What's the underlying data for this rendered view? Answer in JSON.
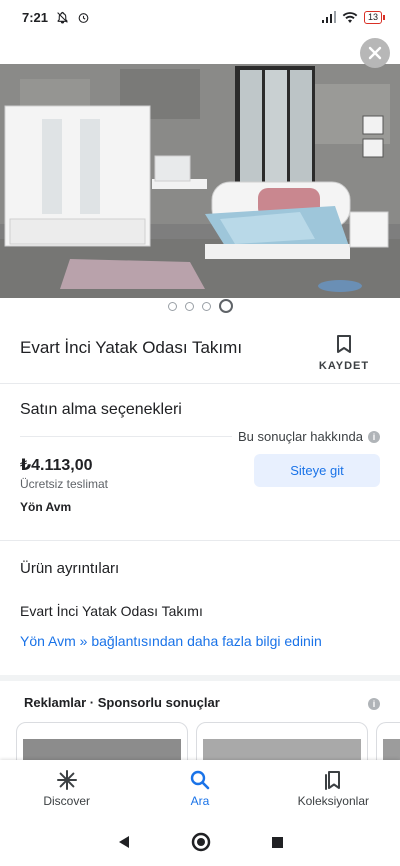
{
  "status": {
    "time": "7:21",
    "battery": "13"
  },
  "product": {
    "title": "Evart İnci Yatak Odası Takımı",
    "save_label": "KAYDET",
    "image_count": 4,
    "active_image": 4
  },
  "purchase": {
    "section_title": "Satın alma seçenekleri",
    "about_label": "Bu sonuçlar hakkında",
    "price": "₺4.113,00",
    "shipping": "Ücretsiz teslimat",
    "seller": "Yön Avm",
    "site_button": "Siteye git"
  },
  "details": {
    "section_title": "Ürün ayrıntıları",
    "description": "Evart İnci Yatak Odası Takımı",
    "more_link": "Yön Avm » bağlantısından daha fazla bilgi edinin"
  },
  "ads": {
    "header": "Reklamlar · Sponsorlu sonuçlar"
  },
  "bottom_nav": {
    "items": [
      {
        "label": "Discover",
        "icon": "asterisk-icon"
      },
      {
        "label": "Ara",
        "icon": "search-icon"
      },
      {
        "label": "Koleksiyonlar",
        "icon": "collections-icon"
      }
    ],
    "active_index": 1
  },
  "colors": {
    "accent": "#1a73e8",
    "button_bg": "#e8f0fe"
  }
}
